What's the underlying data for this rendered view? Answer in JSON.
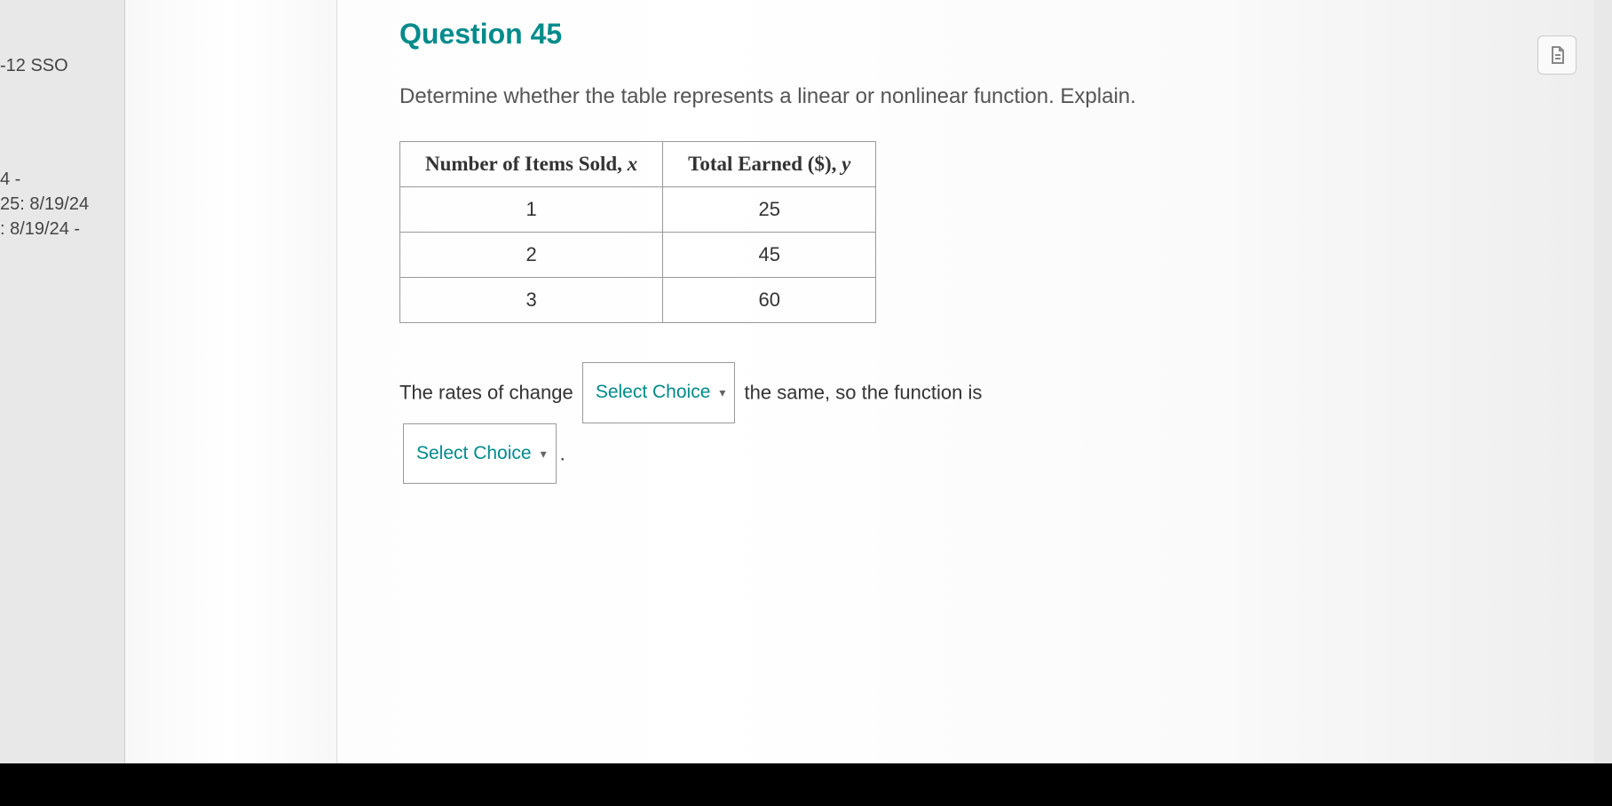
{
  "sidebar": {
    "sso": "-12 SSO",
    "line1": "4 -",
    "line2": "25: 8/19/24",
    "line3": ": 8/19/24 -"
  },
  "question": {
    "title": "Question 45",
    "prompt": "Determine whether the table represents a linear or nonlinear function. Explain."
  },
  "table": {
    "header_x_prefix": "Number of Items Sold, ",
    "header_x_var": "x",
    "header_y_prefix": "Total Earned ($), ",
    "header_y_var": "y",
    "rows": [
      {
        "x": "1",
        "y": "25"
      },
      {
        "x": "2",
        "y": "45"
      },
      {
        "x": "3",
        "y": "60"
      }
    ]
  },
  "answer": {
    "part1": "The rates of change",
    "select_label": "Select Choice",
    "part2": "the same, so the function is",
    "period": "."
  },
  "chart_data": {
    "type": "table",
    "columns": [
      "Number of Items Sold, x",
      "Total Earned ($), y"
    ],
    "rows": [
      [
        1,
        25
      ],
      [
        2,
        45
      ],
      [
        3,
        60
      ]
    ]
  }
}
